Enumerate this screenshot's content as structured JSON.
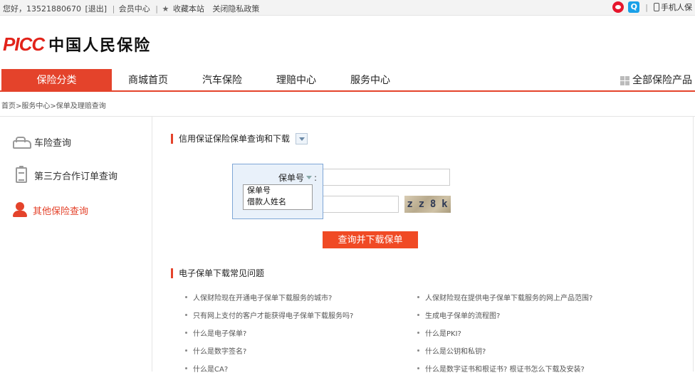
{
  "topbar": {
    "greeting": "您好，13521880670",
    "logout": "[退出]",
    "member": "会员中心",
    "bookmark": "收藏本站",
    "privacy": "关闭隐私政策",
    "mobile": "手机人保"
  },
  "logo": {
    "brand": "PICC",
    "name": "中国人民保险"
  },
  "nav": {
    "category": "保险分类",
    "items": [
      "商城首页",
      "汽车保险",
      "理赔中心",
      "服务中心"
    ],
    "all_products": "全部保险产品"
  },
  "breadcrumb": "首页>服务中心>保单及理赔查询",
  "sidebar": {
    "items": [
      {
        "label": "车险查询",
        "icon": "car-icon",
        "active": false
      },
      {
        "label": "第三方合作订单查询",
        "icon": "clipboard-icon",
        "active": false
      },
      {
        "label": "其他保险查询",
        "icon": "person-icon",
        "active": true
      }
    ]
  },
  "query": {
    "title": "信用保证保险保单查询和下载",
    "field_label": "保单号",
    "field_colon": ":",
    "options": [
      "保单号",
      "借款人姓名"
    ],
    "captcha_text": [
      "z",
      "z",
      "8",
      "k"
    ],
    "submit": "查询并下载保单"
  },
  "faq": {
    "title": "电子保单下载常见问题",
    "left": [
      "人保财险现在开通电子保单下载服务的城市?",
      "只有网上支付的客户才能获得电子保单下载服务吗?",
      "什么是电子保单?",
      "什么是数字签名?",
      "什么是CA?"
    ],
    "right": [
      "人保财险现在提供电子保单下载服务的网上产品范围?",
      "生成电子保单的流程图?",
      "什么是PKI?",
      "什么是公钥和私钥?",
      "什么是数字证书和根证书? 根证书怎么下载及安装?"
    ]
  },
  "colors": {
    "accent": "#e4432b",
    "button": "#f04a24",
    "popup_border": "#7ea6d6"
  }
}
